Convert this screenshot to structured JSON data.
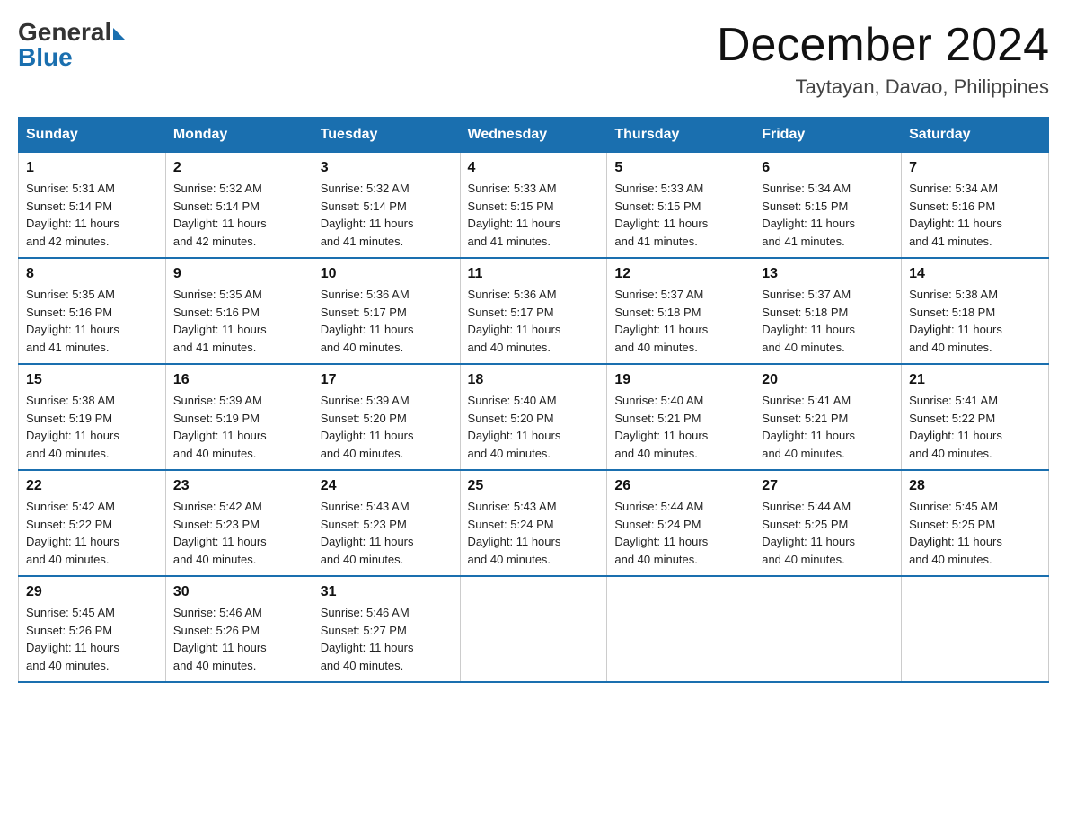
{
  "header": {
    "logo_general": "General",
    "logo_blue": "Blue",
    "month": "December 2024",
    "location": "Taytayan, Davao, Philippines"
  },
  "days_of_week": [
    "Sunday",
    "Monday",
    "Tuesday",
    "Wednesday",
    "Thursday",
    "Friday",
    "Saturday"
  ],
  "weeks": [
    [
      {
        "day": "1",
        "sunrise": "5:31 AM",
        "sunset": "5:14 PM",
        "daylight": "11 hours and 42 minutes."
      },
      {
        "day": "2",
        "sunrise": "5:32 AM",
        "sunset": "5:14 PM",
        "daylight": "11 hours and 42 minutes."
      },
      {
        "day": "3",
        "sunrise": "5:32 AM",
        "sunset": "5:14 PM",
        "daylight": "11 hours and 41 minutes."
      },
      {
        "day": "4",
        "sunrise": "5:33 AM",
        "sunset": "5:15 PM",
        "daylight": "11 hours and 41 minutes."
      },
      {
        "day": "5",
        "sunrise": "5:33 AM",
        "sunset": "5:15 PM",
        "daylight": "11 hours and 41 minutes."
      },
      {
        "day": "6",
        "sunrise": "5:34 AM",
        "sunset": "5:15 PM",
        "daylight": "11 hours and 41 minutes."
      },
      {
        "day": "7",
        "sunrise": "5:34 AM",
        "sunset": "5:16 PM",
        "daylight": "11 hours and 41 minutes."
      }
    ],
    [
      {
        "day": "8",
        "sunrise": "5:35 AM",
        "sunset": "5:16 PM",
        "daylight": "11 hours and 41 minutes."
      },
      {
        "day": "9",
        "sunrise": "5:35 AM",
        "sunset": "5:16 PM",
        "daylight": "11 hours and 41 minutes."
      },
      {
        "day": "10",
        "sunrise": "5:36 AM",
        "sunset": "5:17 PM",
        "daylight": "11 hours and 40 minutes."
      },
      {
        "day": "11",
        "sunrise": "5:36 AM",
        "sunset": "5:17 PM",
        "daylight": "11 hours and 40 minutes."
      },
      {
        "day": "12",
        "sunrise": "5:37 AM",
        "sunset": "5:18 PM",
        "daylight": "11 hours and 40 minutes."
      },
      {
        "day": "13",
        "sunrise": "5:37 AM",
        "sunset": "5:18 PM",
        "daylight": "11 hours and 40 minutes."
      },
      {
        "day": "14",
        "sunrise": "5:38 AM",
        "sunset": "5:18 PM",
        "daylight": "11 hours and 40 minutes."
      }
    ],
    [
      {
        "day": "15",
        "sunrise": "5:38 AM",
        "sunset": "5:19 PM",
        "daylight": "11 hours and 40 minutes."
      },
      {
        "day": "16",
        "sunrise": "5:39 AM",
        "sunset": "5:19 PM",
        "daylight": "11 hours and 40 minutes."
      },
      {
        "day": "17",
        "sunrise": "5:39 AM",
        "sunset": "5:20 PM",
        "daylight": "11 hours and 40 minutes."
      },
      {
        "day": "18",
        "sunrise": "5:40 AM",
        "sunset": "5:20 PM",
        "daylight": "11 hours and 40 minutes."
      },
      {
        "day": "19",
        "sunrise": "5:40 AM",
        "sunset": "5:21 PM",
        "daylight": "11 hours and 40 minutes."
      },
      {
        "day": "20",
        "sunrise": "5:41 AM",
        "sunset": "5:21 PM",
        "daylight": "11 hours and 40 minutes."
      },
      {
        "day": "21",
        "sunrise": "5:41 AM",
        "sunset": "5:22 PM",
        "daylight": "11 hours and 40 minutes."
      }
    ],
    [
      {
        "day": "22",
        "sunrise": "5:42 AM",
        "sunset": "5:22 PM",
        "daylight": "11 hours and 40 minutes."
      },
      {
        "day": "23",
        "sunrise": "5:42 AM",
        "sunset": "5:23 PM",
        "daylight": "11 hours and 40 minutes."
      },
      {
        "day": "24",
        "sunrise": "5:43 AM",
        "sunset": "5:23 PM",
        "daylight": "11 hours and 40 minutes."
      },
      {
        "day": "25",
        "sunrise": "5:43 AM",
        "sunset": "5:24 PM",
        "daylight": "11 hours and 40 minutes."
      },
      {
        "day": "26",
        "sunrise": "5:44 AM",
        "sunset": "5:24 PM",
        "daylight": "11 hours and 40 minutes."
      },
      {
        "day": "27",
        "sunrise": "5:44 AM",
        "sunset": "5:25 PM",
        "daylight": "11 hours and 40 minutes."
      },
      {
        "day": "28",
        "sunrise": "5:45 AM",
        "sunset": "5:25 PM",
        "daylight": "11 hours and 40 minutes."
      }
    ],
    [
      {
        "day": "29",
        "sunrise": "5:45 AM",
        "sunset": "5:26 PM",
        "daylight": "11 hours and 40 minutes."
      },
      {
        "day": "30",
        "sunrise": "5:46 AM",
        "sunset": "5:26 PM",
        "daylight": "11 hours and 40 minutes."
      },
      {
        "day": "31",
        "sunrise": "5:46 AM",
        "sunset": "5:27 PM",
        "daylight": "11 hours and 40 minutes."
      },
      null,
      null,
      null,
      null
    ]
  ],
  "labels": {
    "sunrise": "Sunrise:",
    "sunset": "Sunset:",
    "daylight": "Daylight:"
  }
}
